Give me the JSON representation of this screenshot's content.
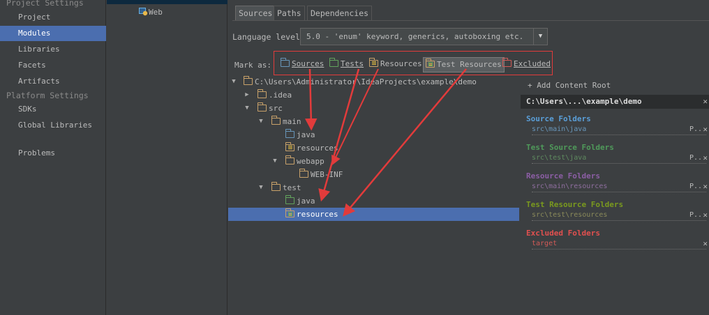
{
  "nav": {
    "project_settings": "Project Settings",
    "project_items": [
      "Project",
      "Modules",
      "Libraries",
      "Facets",
      "Artifacts"
    ],
    "platform_settings": "Platform Settings",
    "platform_items": [
      "SDKs",
      "Global Libraries"
    ],
    "problems": "Problems",
    "selected": "Modules"
  },
  "module": {
    "web_label": "Web"
  },
  "tabs": [
    "Sources",
    "Paths",
    "Dependencies"
  ],
  "language": {
    "label": "Language level:",
    "value": "5.0 - 'enum' keyword, generics, autoboxing etc."
  },
  "mark_as": {
    "label": "Mark as:",
    "buttons": [
      "Sources",
      "Tests",
      "Resources",
      "Test Resources",
      "Excluded"
    ]
  },
  "tree": {
    "root": "C:\\Users\\Administrator\\IdeaProjects\\example\\demo",
    "idea": ".idea",
    "src": "src",
    "main": "main",
    "main_java": "java",
    "main_resources": "resources",
    "webapp": "webapp",
    "webinf": "WEB-INF",
    "test": "test",
    "test_java": "java",
    "test_resources": "resources"
  },
  "right_panel": {
    "add_root": "+ Add Content Root",
    "root_path": "C:\\Users\\...\\example\\demo",
    "sections": [
      {
        "title": "Source Folders",
        "path": "src\\main\\java",
        "title_color": "#5a9fd9",
        "path_color": "#6896ba"
      },
      {
        "title": "Test Source Folders",
        "path": "src\\test\\java",
        "title_color": "#4f9a5a",
        "path_color": "#5f8a5f"
      },
      {
        "title": "Resource Folders",
        "path": "src\\main\\resources",
        "title_color": "#8c5ea5",
        "path_color": "#8e6e9e"
      },
      {
        "title": "Test Resource Folders",
        "path": "src\\test\\resources",
        "title_color": "#7a9a1e",
        "path_color": "#8a8a5a"
      },
      {
        "title": "Excluded Folders",
        "path": "target",
        "title_color": "#e2504f",
        "path_color": "#d05a57"
      }
    ],
    "p_label": "P.."
  },
  "colors": {
    "selection": "#4b6eaf",
    "annotation_red": "#e23b3b"
  }
}
